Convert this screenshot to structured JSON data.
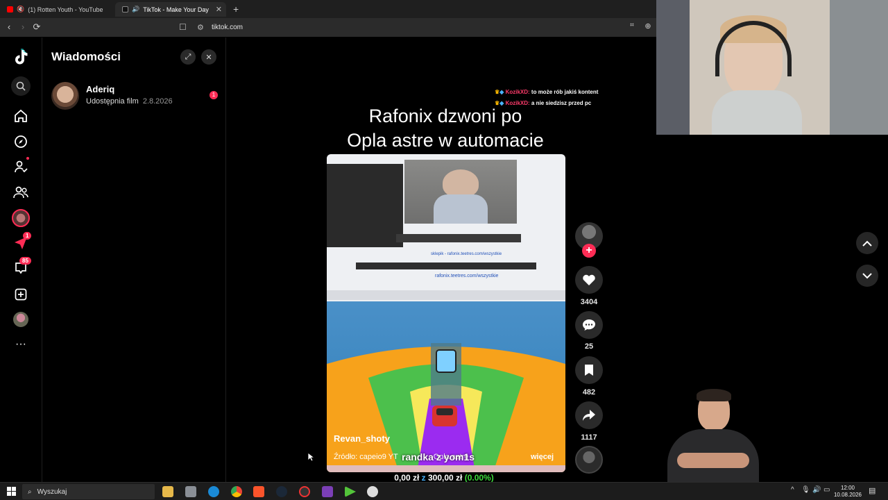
{
  "browser": {
    "tabs": [
      {
        "label": "(1) Rotten Youth - YouTube",
        "icon": "youtube-icon",
        "muted": true
      },
      {
        "label": "TikTok - Make Your Day",
        "icon": "tiktok-icon",
        "active": true
      }
    ],
    "url": "tiktok.com"
  },
  "sidebar": {
    "items": [
      {
        "name": "search",
        "icon": "search-icon"
      },
      {
        "name": "home",
        "icon": "home-icon"
      },
      {
        "name": "explore",
        "icon": "compass-icon"
      },
      {
        "name": "following",
        "icon": "following-icon"
      },
      {
        "name": "friends",
        "icon": "friends-icon"
      },
      {
        "name": "live",
        "icon": "live-icon"
      },
      {
        "name": "messages",
        "icon": "send-icon",
        "badge": "1"
      },
      {
        "name": "activity",
        "icon": "inbox-icon",
        "badge": "85"
      },
      {
        "name": "upload",
        "icon": "plus-square-icon"
      },
      {
        "name": "profile",
        "icon": "avatar-icon"
      },
      {
        "name": "more",
        "icon": "ellipsis-icon"
      }
    ]
  },
  "messages": {
    "title": "Wiadomości",
    "conversations": [
      {
        "name": "Aderiq",
        "preview": "Udostępnia film",
        "date": "2.8.2026",
        "unread": "1"
      }
    ]
  },
  "video": {
    "caption_line1": "Rafonix dzwoni po",
    "caption_line2": "Opla astre w automacie",
    "author": "Revan_shoty",
    "description": "Źródło: capeio9 YT",
    "description_tail": "Opla astre",
    "more_label": "więcej",
    "overlay_text": "randka z yom1s",
    "screen_links": [
      "sklepik - rafonix.teetres.com/wszystkie",
      "rafonix.teetres.com/wszystkie"
    ],
    "likes": "3404",
    "comments": "25",
    "saves": "482",
    "shares": "1117"
  },
  "stream": {
    "chat": [
      {
        "user": "KozikXD:",
        "text": "to może rób jakiś kontent"
      },
      {
        "user": "KozikXD:",
        "text": "a nie siedzisz przed pc"
      }
    ],
    "donation_amount": "0,00 zł",
    "donation_sep": "z",
    "donation_goal": "300,00 zł",
    "donation_pct": "(0.00%)"
  },
  "taskbar": {
    "search_placeholder": "Wyszukaj",
    "time": "12:00",
    "date": "10.08.2026"
  },
  "colors": {
    "accent": "#fe2c55",
    "green": "#3ddc3d"
  }
}
